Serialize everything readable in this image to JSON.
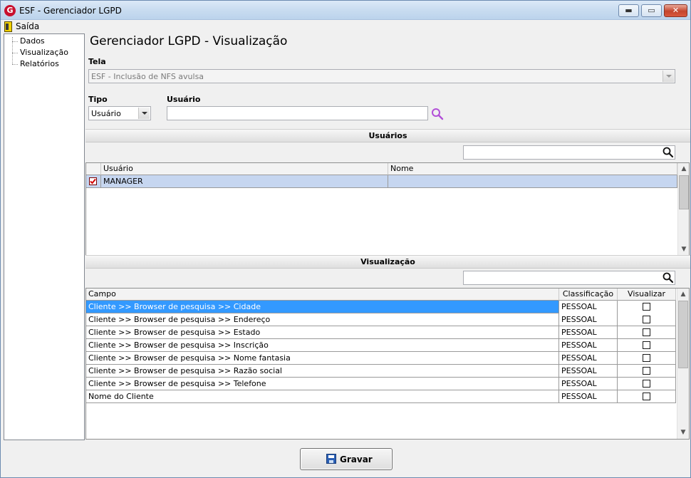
{
  "window": {
    "title": "ESF - Gerenciador LGPD",
    "app_icon": "G",
    "controls": {
      "minimize": "▬",
      "maximize": "▭",
      "close": "✕"
    }
  },
  "menu": {
    "saida": "Saída"
  },
  "tree": {
    "items": [
      "Dados",
      "Visualização",
      "Relatórios"
    ]
  },
  "main": {
    "heading": "Gerenciador LGPD - Visualização",
    "tela_label": "Tela",
    "tela_value": "ESF - Inclusão de NFS avulsa",
    "tipo_label": "Tipo",
    "tipo_value": "Usuário",
    "usuario_label": "Usuário",
    "usuario_value": ""
  },
  "usuarios_section": {
    "title": "Usuários",
    "search_value": "",
    "columns": [
      "Usuário",
      "Nome"
    ],
    "rows": [
      {
        "checked": true,
        "usuario": "MANAGER",
        "nome": ""
      }
    ]
  },
  "visualizacao_section": {
    "title": "Visualização",
    "search_value": "",
    "columns": [
      "Campo",
      "Classificação",
      "Visualizar"
    ],
    "rows": [
      {
        "campo": "Cliente >> Browser de pesquisa >> Cidade",
        "classificacao": "PESSOAL",
        "visualizar": false
      },
      {
        "campo": "Cliente >> Browser de pesquisa >> Endereço",
        "classificacao": "PESSOAL",
        "visualizar": false
      },
      {
        "campo": "Cliente >> Browser de pesquisa >> Estado",
        "classificacao": "PESSOAL",
        "visualizar": false
      },
      {
        "campo": "Cliente >> Browser de pesquisa >> Inscrição",
        "classificacao": "PESSOAL",
        "visualizar": false
      },
      {
        "campo": "Cliente >> Browser de pesquisa >> Nome fantasia",
        "classificacao": "PESSOAL",
        "visualizar": false
      },
      {
        "campo": "Cliente >> Browser de pesquisa >> Razão social",
        "classificacao": "PESSOAL",
        "visualizar": false
      },
      {
        "campo": "Cliente >> Browser de pesquisa >> Telefone",
        "classificacao": "PESSOAL",
        "visualizar": false
      },
      {
        "campo": "Nome do Cliente",
        "classificacao": "PESSOAL",
        "visualizar": false
      }
    ]
  },
  "footer": {
    "save_label": "Gravar"
  },
  "colors": {
    "selection": "#3399ff",
    "accent_icon": "#b24fd8",
    "check_red": "#d40000"
  }
}
